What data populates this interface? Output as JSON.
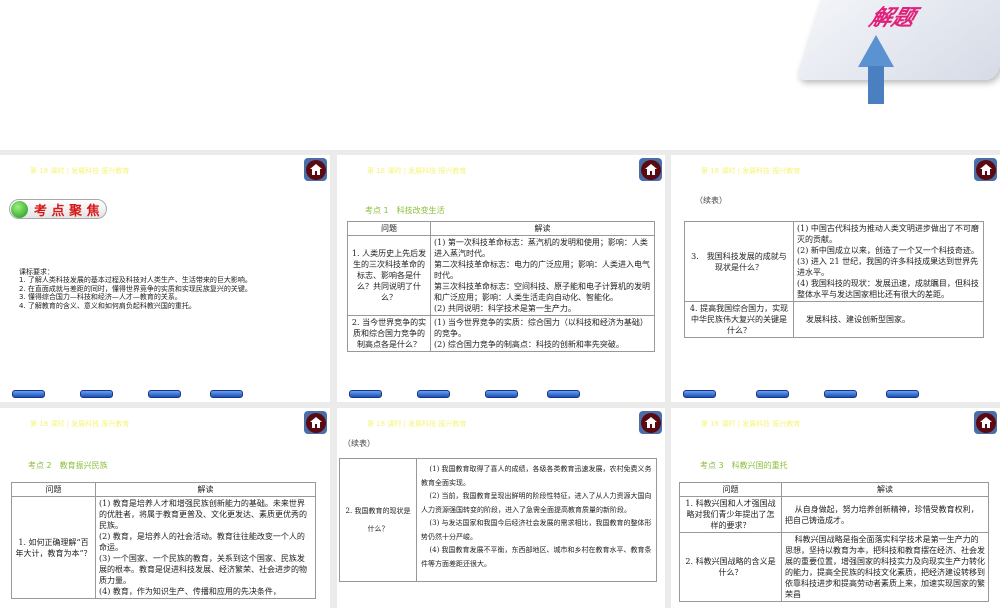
{
  "header": "第 18 课时 | 发展科技 振兴教育",
  "top_slide": {
    "graphic_text": "解题"
  },
  "slide1": {
    "badge": "考 点 聚 焦",
    "title": "课标要求：",
    "items": [
      "1. 了解人类科技发展的基本过程及科技对人类生产、生活带来的巨大影响。",
      "2. 在直面成就与差距的同时，懂得世界竞争的实质和实现民族复兴的关键。",
      "3. 懂得综合国力—科技和经济—人才—教育的关系。",
      "4. 了解教育的含义、意义和如何肩负起科教兴国的重托。"
    ]
  },
  "slide2": {
    "heading": "考点 1　科技改变生活",
    "col_q": "问题",
    "col_a": "解读",
    "rows": [
      {
        "q": "1. 人类历史上先后发生的三次科技革命的标志、影响各是什么？共同说明了什么？",
        "a": [
          "(1) 第一次科技革命标志：蒸汽机的发明和使用；影响：人类进入蒸汽时代。",
          "第二次科技革命标志：电力的广泛应用；影响：人类进入电气时代。",
          "第三次科技革命标志：空间科技、原子能和电子计算机的发明和广泛应用；影响：人类生活走向自动化、智能化。",
          "(2) 共同说明：科学技术是第一生产力。"
        ]
      },
      {
        "q": "2. 当今世界竞争的实质和综合国力竞争的制高点各是什么？",
        "a": [
          "(1) 当今世界竞争的实质：综合国力（以科技和经济为基础）的竞争。",
          "(2) 综合国力竞争的制高点：科技的创新和率先突破。"
        ]
      }
    ]
  },
  "slide3": {
    "cont": "（续表）",
    "rows": [
      {
        "q": "3.　我国科技发展的成就与现状是什么？",
        "a": [
          "(1) 中国古代科技为推动人类文明进步做出了不可磨灭的贡献。",
          "(2) 新中国成立以来，创造了一个又一个科技奇迹。",
          "(3) 进入 21 世纪，我国的许多科技成果达到世界先进水平。",
          "(4) 我国科技的现状：发展迅速，成就瞩目，但科技整体水平与发达国家相比还有很大的差距。"
        ]
      },
      {
        "q": "4. 提高我国综合国力，实现中华民族伟大复兴的关键是什么？",
        "a": [
          "发展科技、建设创新型国家。"
        ]
      }
    ]
  },
  "slide4": {
    "heading": "考点 2　教育振兴民族",
    "col_q": "问题",
    "col_a": "解读",
    "rows": [
      {
        "q": "1. 如何正确理解“百年大计，教育为本”？",
        "a": [
          "(1) 教育是培养人才和增强民族创新能力的基础。未来世界的优胜者，将属于教育更普及、文化更发达、素质更优秀的民族。",
          "(2) 教育，是培养人的社会活动。教育往往能改变一个人的命运。",
          "(3) 一个国家、一个民族的教育，关系到这个国家、民族发展的根本。教育是促进科技发展、经济繁荣、社会进步的物质力量。",
          "(4) 教育，作为知识生产、传播和应用的先决条件，"
        ]
      }
    ]
  },
  "slide5": {
    "cont": "（续表）",
    "rows": [
      {
        "q": "2. 我国教育的现状是什么？",
        "a": [
          "(1) 我国教育取得了喜人的成绩，各级各类教育迅速发展，农村免费义务教育全面实现。",
          "(2) 当前，我国教育呈现出鲜明的阶段性特征，进入了从人力资源大国向人力资源强国转变的阶段，进入了急需全面提高教育质量的新阶段。",
          "(3) 与发达国家和我国今后经济社会发展的需求相比，我国教育的整体形势仍然十分严峻。",
          "(4) 我国教育发展不平衡，东西部地区、城市和乡村在教育水平、教育条件等方面差距还很大。"
        ]
      }
    ]
  },
  "slide6": {
    "heading": "考点 3　科教兴国的重托",
    "col_q": "问题",
    "col_a": "解读",
    "rows": [
      {
        "q": "1. 科教兴国和人才强国战略对我们青少年提出了怎样的要求？",
        "a": [
          "从自身做起，努力培养创新精神，珍惜受教育权利，把自己铸造成才。"
        ]
      },
      {
        "q": "2. 科教兴国战略的含义是什么？",
        "a": [
          "科教兴国战略是指全面落实科学技术是第一生产力的思想，坚持以教育为本，把科技和教育摆在经济、社会发展的重要位置，增强国家的科技实力及向现实生产力转化的能力，提高全民族的科技文化素质，把经济建设转移到依靠科技进步和提高劳动者素质上来，加速实现国家的繁荣昌"
        ]
      }
    ]
  }
}
